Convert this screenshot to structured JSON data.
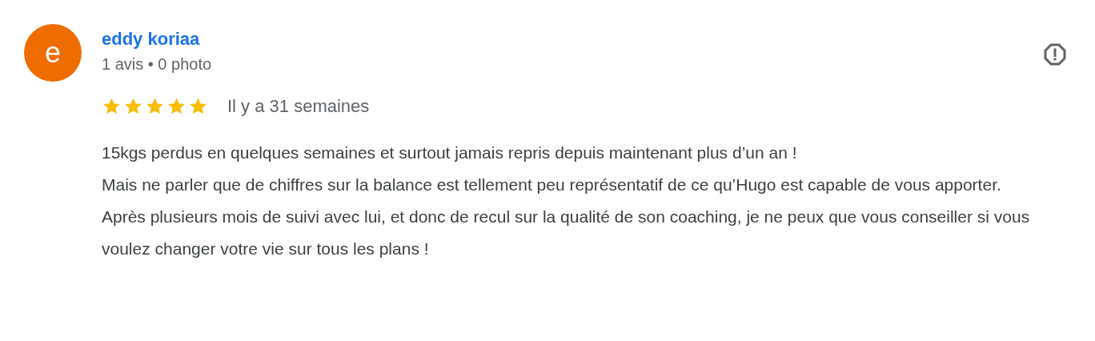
{
  "review": {
    "avatar_letter": "e",
    "author": "eddy koriaa",
    "meta": "1 avis • 0 photo",
    "stars": 5,
    "time": "Il y a 31 semaines",
    "text": "15kgs perdus en quelques semaines et surtout jamais repris depuis maintenant plus d’un an !\nMais ne parler que de chiffres sur la balance est tellement peu représentatif de ce qu’Hugo est capable de vous apporter.\nAprès plusieurs mois de suivi avec lui, et donc de recul sur la qualité de son coaching, je ne peux que vous conseiller si vous voulez changer votre vie sur tous les plans !"
  }
}
